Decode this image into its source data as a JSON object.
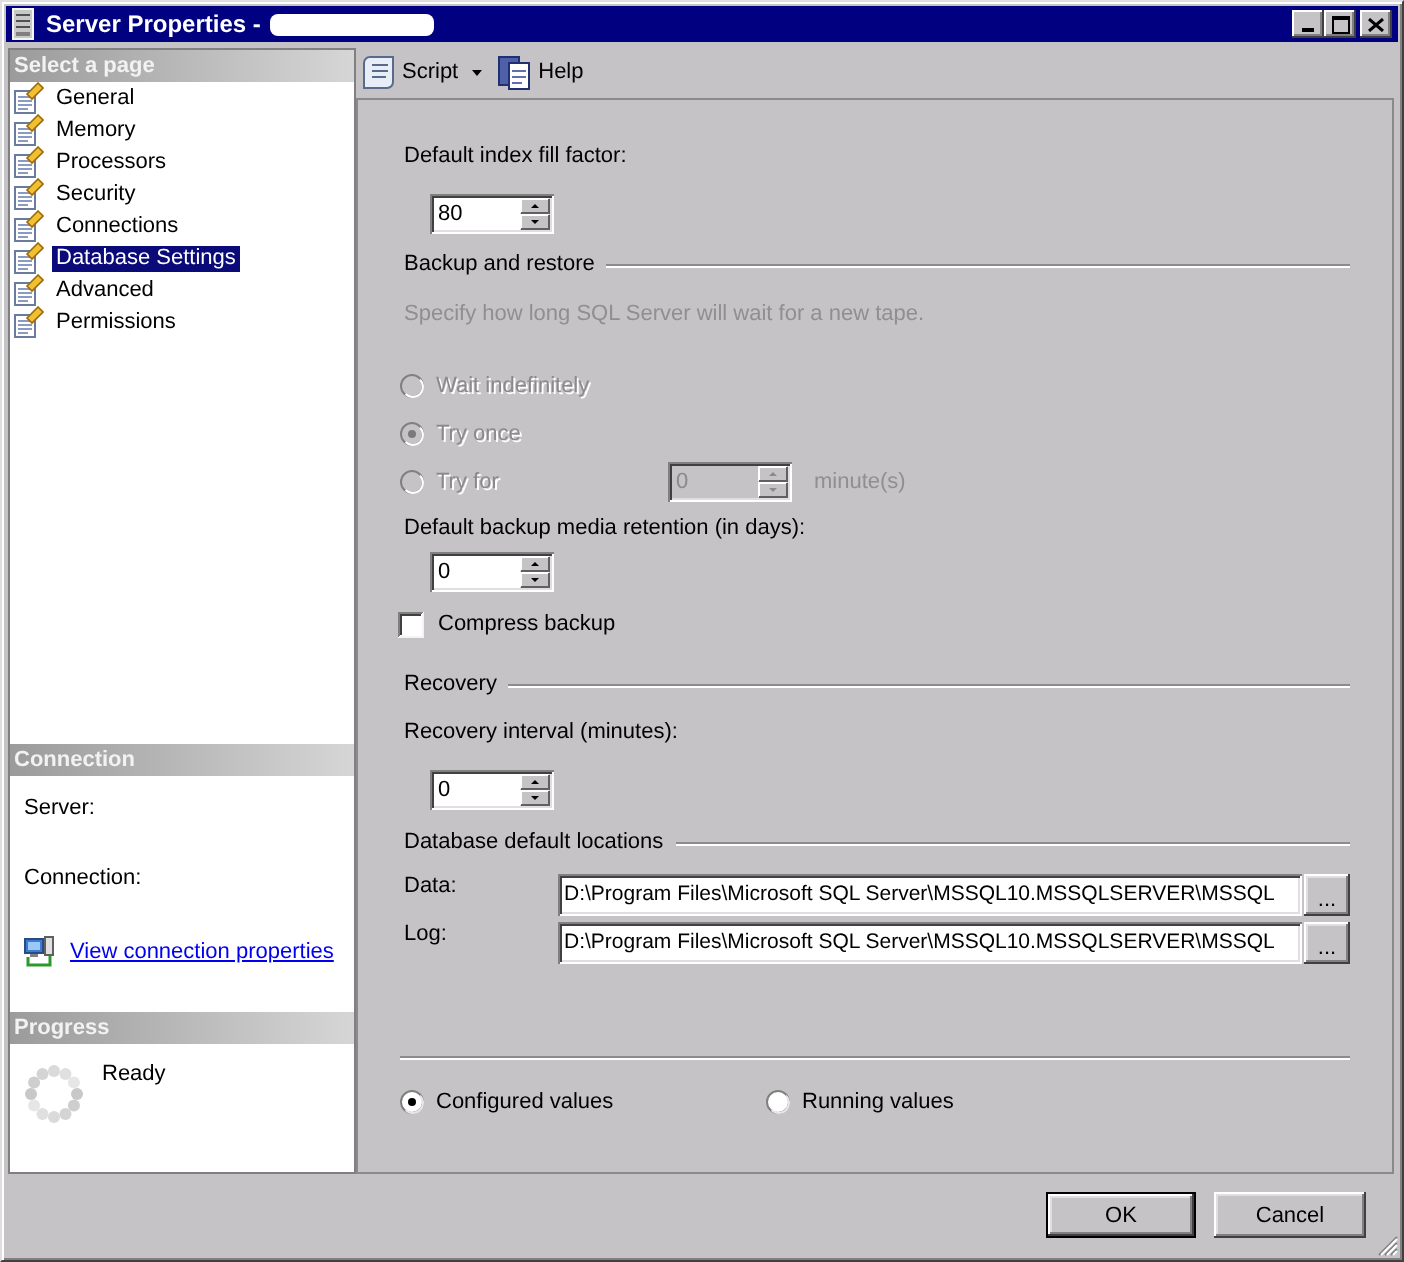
{
  "window": {
    "title": "Server Properties -"
  },
  "page_list": {
    "header": "Select a page",
    "items": [
      {
        "label": "General",
        "selected": false
      },
      {
        "label": "Memory",
        "selected": false
      },
      {
        "label": "Processors",
        "selected": false
      },
      {
        "label": "Security",
        "selected": false
      },
      {
        "label": "Connections",
        "selected": false
      },
      {
        "label": "Database Settings",
        "selected": true
      },
      {
        "label": "Advanced",
        "selected": false
      },
      {
        "label": "Permissions",
        "selected": false
      }
    ]
  },
  "connection": {
    "header": "Connection",
    "fields": [
      {
        "label": "Server:"
      },
      {
        "label": "Connection:"
      }
    ],
    "link": "View connection properties"
  },
  "progress": {
    "header": "Progress",
    "status": "Ready"
  },
  "toolbar": [
    {
      "kind": "script",
      "label": "Script",
      "dropdown": true
    },
    {
      "kind": "help",
      "label": "Help",
      "dropdown": false
    }
  ],
  "fill_factor": {
    "label": "Default index fill factor:",
    "value": "80"
  },
  "backup": {
    "heading": "Backup and restore",
    "hint": "Specify how long SQL Server will wait for a new tape.",
    "disabled": true,
    "options": [
      {
        "kind": "plain",
        "label": "Wait indefinitely",
        "selected": false
      },
      {
        "kind": "plain",
        "label": "Try once",
        "selected": true
      },
      {
        "kind": "timed",
        "label": "Try for",
        "selected": false,
        "value": "0",
        "unit": "minute(s)"
      }
    ],
    "retention": {
      "label": "Default backup media retention (in days):",
      "value": "0"
    },
    "compress": {
      "label": "Compress backup",
      "checked": false
    }
  },
  "recovery": {
    "heading": "Recovery",
    "interval": {
      "label": "Recovery interval (minutes):",
      "value": "0"
    }
  },
  "locations": {
    "heading": "Database default locations",
    "rows": [
      {
        "label": "Data:",
        "value": "D:\\Program Files\\Microsoft SQL Server\\MSSQL10.MSSQLSERVER\\MSSQL",
        "button": "..."
      },
      {
        "label": "Log:",
        "value": "D:\\Program Files\\Microsoft SQL Server\\MSSQL10.MSSQLSERVER\\MSSQL",
        "button": "..."
      }
    ]
  },
  "view_mode": [
    {
      "label": "Configured values",
      "selected": true
    },
    {
      "label": "Running values",
      "selected": false
    }
  ],
  "buttons": [
    {
      "label": "OK",
      "default": true
    },
    {
      "label": "Cancel",
      "default": false
    }
  ]
}
